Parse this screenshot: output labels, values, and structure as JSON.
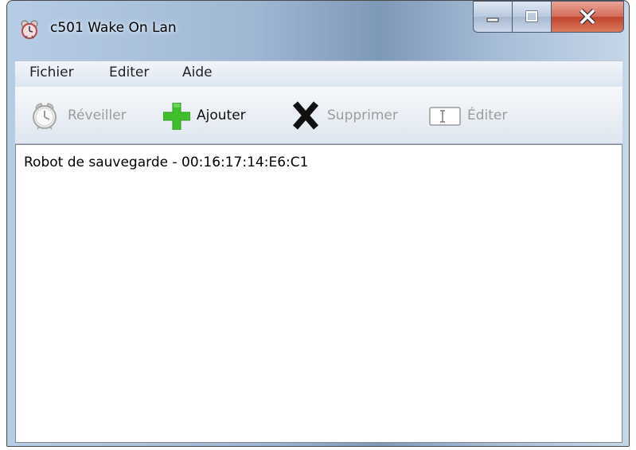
{
  "window": {
    "title": "c501 Wake On Lan"
  },
  "menu": {
    "items": [
      {
        "label": "Fichier"
      },
      {
        "label": "Editer"
      },
      {
        "label": "Aide"
      }
    ]
  },
  "toolbar": {
    "wake_label": "Réveiller",
    "add_label": "Ajouter",
    "delete_label": "Supprimer",
    "edit_label": "Éditer",
    "wake_enabled": false,
    "add_enabled": true,
    "delete_enabled": false,
    "edit_enabled": false
  },
  "list": {
    "items": [
      {
        "text": "Robot de sauvegarde - 00:16:17:14:E6:C1"
      }
    ]
  },
  "colors": {
    "add_icon": "#3fbf2c",
    "delete_icon": "#111111",
    "disabled_text": "#9c9c9c"
  }
}
